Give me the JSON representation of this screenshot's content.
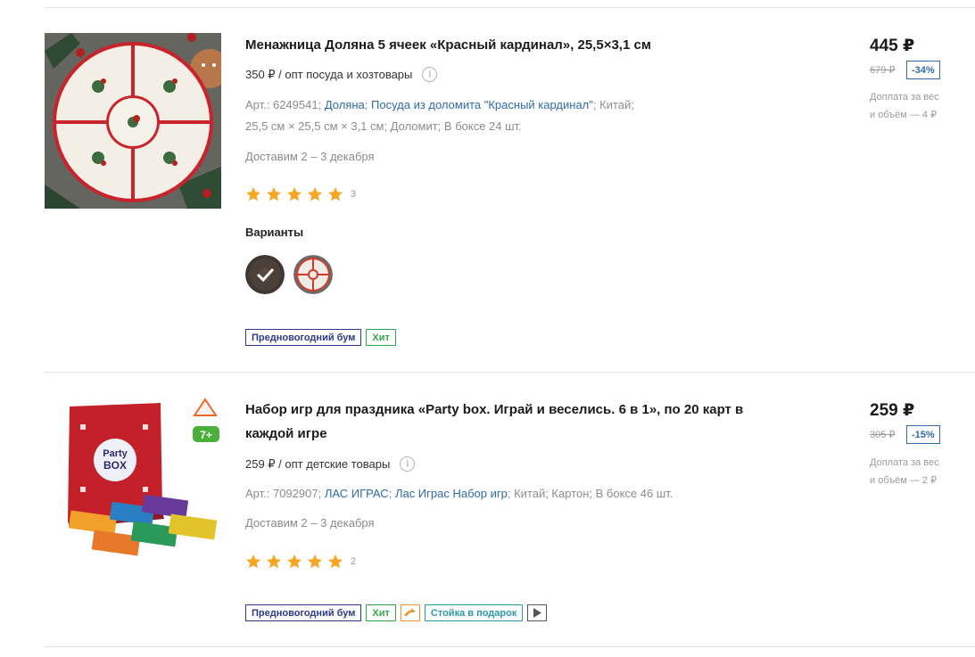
{
  "products": [
    {
      "title": "Менажница Доляна 5 ячеек «Красный кардинал», 25,5×3,1 см",
      "opt_price": "350 ₽ / опт посуда и хозтовары",
      "meta_line1": {
        "art": "Арт.: 6249541;",
        "brand": "Доляна",
        "sep": ";",
        "series": "Посуда из доломита \"Красный кардинал\"",
        "tail": "; Китай;"
      },
      "meta_line2": "25,5 см × 25,5 см × 3,1 см; Доломит; В боксе 24 шт.",
      "delivery": "Доставим 2 – 3 декабря",
      "rating": 5,
      "review_count": "3",
      "variants_title": "Варианты",
      "badges": [
        "Предновогодний бум",
        "Хит"
      ],
      "price": "445 ₽",
      "old_price": "679 ₽",
      "discount": "-34%",
      "surcharge_line1": "Доплата за вес",
      "surcharge_line2": "и объём — 4 ₽"
    },
    {
      "title": "Набор игр для праздника «Party box. Играй и веселись. 6 в 1», по 20 карт в каждой игре",
      "opt_price": "259 ₽ / опт детские товары",
      "meta_line1": {
        "art": "Арт.: 7092907;",
        "brand": "ЛАС ИГРАС",
        "sep": ";",
        "series": "Лас Играс Набор игр",
        "tail": "; Китай; Картон; В боксе 46 шт."
      },
      "delivery": "Доставим 2 – 3 декабря",
      "rating": 5,
      "review_count": "2",
      "age_badge": "7+",
      "box_label_1": "Party",
      "box_label_2": "BOX",
      "badges": [
        "Предновогодний бум",
        "Хит",
        "Стойка в подарок"
      ],
      "badge_icons": [
        "dolphin-icon",
        "play-icon"
      ],
      "price": "259 ₽",
      "old_price": "305 ₽",
      "discount": "-15%",
      "surcharge_line1": "Доплата за вес",
      "surcharge_line2": "и объём — 2 ₽"
    }
  ],
  "colors": {
    "link": "#2f6ba8",
    "star": "#f5a623",
    "badge_new": "#2d3a8c",
    "badge_hit": "#2fa84a",
    "badge_gift": "#2a9aa8",
    "badge_dolphin": "#e8982a"
  }
}
